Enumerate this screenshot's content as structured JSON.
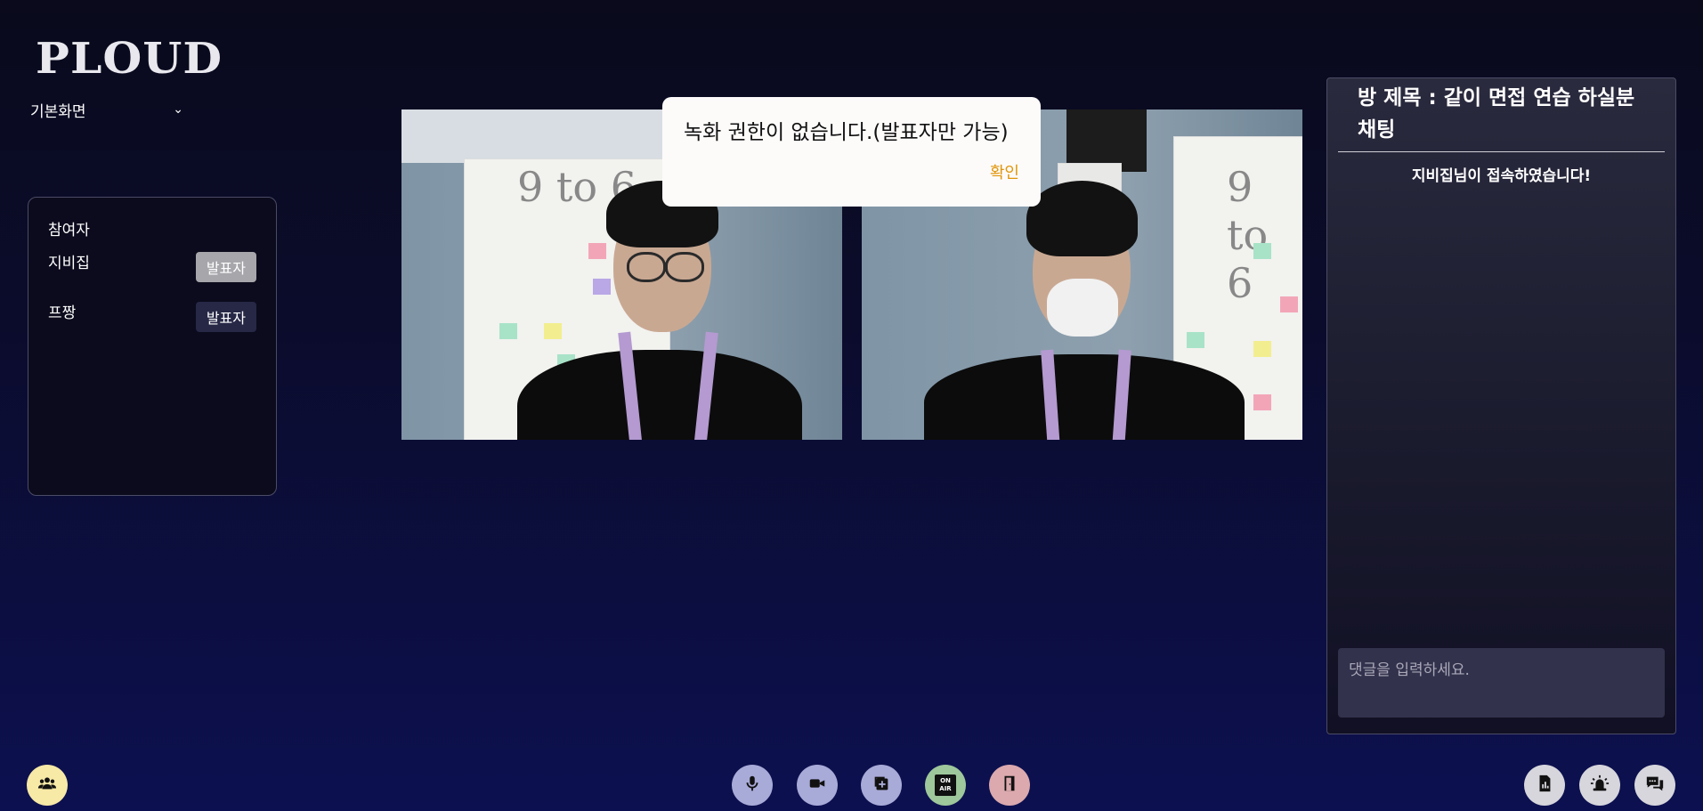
{
  "app": {
    "logo": "PLOUD"
  },
  "view": {
    "selected": "기본화면"
  },
  "participants": {
    "title": "참여자",
    "list": [
      {
        "name": "지비집",
        "role": "발표자",
        "active": true
      },
      {
        "name": "프짱",
        "role": "발표자",
        "active": false
      }
    ]
  },
  "dialog": {
    "message": "녹화 권한이 없습니다.(발표자만 가능)",
    "confirm": "확인"
  },
  "chat": {
    "title": "방 제목 : 같이 면접 연습 하실분 채팅",
    "system_message": "지비집님이 접속하였습니다!",
    "input_placeholder": "댓글을 입력하세요."
  },
  "controls": {
    "participants_icon": "users-icon",
    "mic_icon": "microphone-icon",
    "camera_icon": "video-camera-icon",
    "share_icon": "screen-share-icon",
    "onair_icon": "on-air-icon",
    "onair_text_1": "ON",
    "onair_text_2": "AIR",
    "exit_icon": "door-exit-icon",
    "report_icon": "document-chart-icon",
    "alarm_icon": "siren-icon",
    "chat_icon": "chat-bubbles-icon"
  },
  "colors": {
    "accent_yellow": "#f7e9a6",
    "control_purple": "#a8aad8",
    "onair_green": "#9ec79b",
    "exit_pink": "#dba9ae",
    "confirm_orange": "#e0960a"
  }
}
